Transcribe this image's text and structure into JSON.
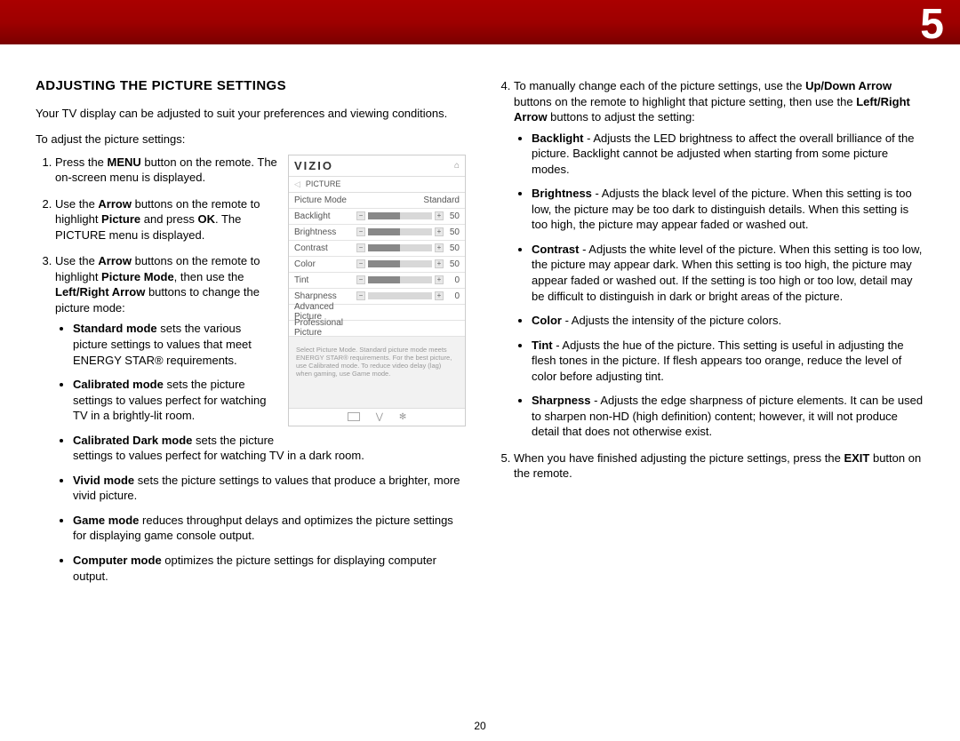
{
  "chapter": "5",
  "page_number": "20",
  "section_title": "ADJUSTING THE PICTURE SETTINGS",
  "intro": "Your TV display can be adjusted to suit your preferences and viewing conditions.",
  "lead": "To adjust the picture settings:",
  "steps": {
    "s1_pre": "Press the ",
    "s1_b1": "MENU",
    "s1_post": " button on the remote. The on-screen menu is displayed.",
    "s2_pre": "Use the ",
    "s2_b1": "Arrow",
    "s2_mid": " buttons on the remote to highlight ",
    "s2_b2": "Picture",
    "s2_post": " and press ",
    "s2_b3": "OK",
    "s2_end": ". The PICTURE menu is displayed.",
    "s3_pre": "Use the ",
    "s3_b1": "Arrow",
    "s3_mid": " buttons on the remote to highlight ",
    "s3_b2": "Picture Mode",
    "s3_post": ", then use the ",
    "s3_b3": "Left/Right Arrow",
    "s3_end": " buttons to change the picture mode:"
  },
  "modes": [
    {
      "name": "Standard mode",
      "desc": " sets the various picture settings to values that meet ENERGY STAR® requirements."
    },
    {
      "name": "Calibrated mode",
      "desc": " sets the picture settings to values perfect for watching TV in a brightly-lit room."
    },
    {
      "name": "Calibrated Dark mode",
      "desc": " sets the picture settings to values perfect for watching TV in a dark room."
    },
    {
      "name": "Vivid mode",
      "desc": " sets the picture settings to values that produce a brighter, more vivid picture."
    },
    {
      "name": "Game mode",
      "desc": " reduces throughput delays and optimizes the picture settings for displaying game console output."
    },
    {
      "name": "Computer mode",
      "desc": " optimizes the picture settings for displaying computer output."
    }
  ],
  "step4": {
    "pre": "To manually change each of the picture settings, use the ",
    "b1": "Up/Down Arrow",
    "mid": " buttons on the remote to highlight that picture setting, then use the ",
    "b2": "Left/Right Arrow",
    "post": " buttons to adjust the setting:"
  },
  "settings_defs": [
    {
      "name": "Backlight",
      "desc": " - Adjusts the LED brightness to affect the overall brilliance of the picture. Backlight cannot be adjusted when starting from some picture modes."
    },
    {
      "name": "Brightness",
      "desc": " - Adjusts the black level of the picture. When this setting is too low, the picture may be too dark to distinguish details. When this setting is too high, the picture may appear faded or washed out."
    },
    {
      "name": "Contrast",
      "desc": " - Adjusts the white level of the picture. When this setting is too low, the picture may appear dark. When this setting is too high, the picture may appear faded or washed out. If the setting is too high or too low, detail may be difficult to distinguish in dark or bright areas of the picture."
    },
    {
      "name": "Color",
      "desc": " - Adjusts the intensity of the picture colors."
    },
    {
      "name": "Tint",
      "desc": " - Adjusts the hue of the picture. This setting is useful in adjusting the flesh tones in the picture. If flesh appears too orange, reduce the level of color before adjusting tint."
    },
    {
      "name": "Sharpness",
      "desc": " - Adjusts the edge sharpness of picture elements. It can be used to sharpen non-HD (high definition) content; however, it will not produce detail that does not otherwise exist."
    }
  ],
  "step5": {
    "pre": "When you have finished adjusting the picture settings, press the ",
    "b1": "EXIT",
    "post": " button on the remote."
  },
  "vizio": {
    "logo": "VIZIO",
    "menu_title": "PICTURE",
    "rows": [
      {
        "label": "Picture Mode",
        "value": "Standard",
        "slider": false
      },
      {
        "label": "Backlight",
        "value": "50",
        "slider": true,
        "pct": 50
      },
      {
        "label": "Brightness",
        "value": "50",
        "slider": true,
        "pct": 50
      },
      {
        "label": "Contrast",
        "value": "50",
        "slider": true,
        "pct": 50
      },
      {
        "label": "Color",
        "value": "50",
        "slider": true,
        "pct": 50
      },
      {
        "label": "Tint",
        "value": "0",
        "slider": true,
        "pct": 50
      },
      {
        "label": "Sharpness",
        "value": "0",
        "slider": true,
        "pct": 0
      },
      {
        "label": "Advanced Picture",
        "value": "",
        "slider": false
      },
      {
        "label": "Professional Picture",
        "value": "",
        "slider": false
      }
    ],
    "tip": "Select Picture Mode. Standard picture mode meets ENERGY STAR® requirements. For the best picture, use Calibrated mode. To reduce video delay (lag) when gaming, use Game mode."
  }
}
